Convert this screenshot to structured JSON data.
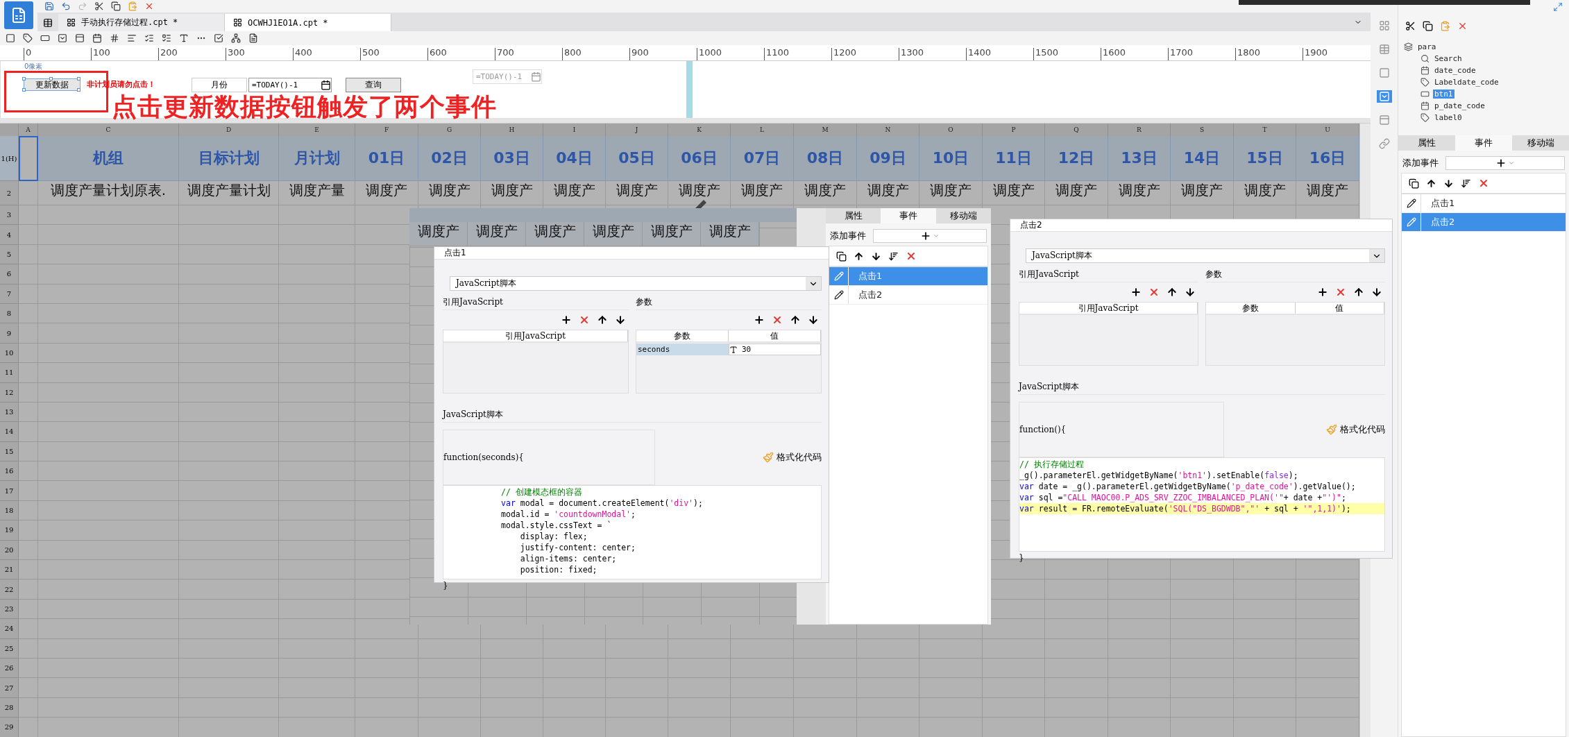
{
  "tabs": [
    {
      "label": "手动执行存储过程.cpt *",
      "selected": false
    },
    {
      "label": "OCWHJ1EO1A.cpt *",
      "selected": true
    }
  ],
  "ruler": {
    "ticks": [
      "0",
      "100",
      "200",
      "300",
      "400",
      "500",
      "600",
      "700",
      "800",
      "900",
      "1000",
      "1100",
      "1200",
      "1300",
      "1400",
      "1500",
      "1600",
      "1700",
      "1800",
      "1900"
    ]
  },
  "parameter_pane": {
    "size_hint": "0像素",
    "widgets": [
      {
        "kind": "button",
        "text": "更新数据",
        "selected": true
      },
      {
        "kind": "warning",
        "text": "非计划员请勿点击！"
      },
      {
        "kind": "label",
        "text": "月份"
      },
      {
        "kind": "date",
        "value": "=TODAY()-1"
      },
      {
        "kind": "button",
        "text": "查询",
        "selected": false
      },
      {
        "kind": "date_disabled",
        "value": "=TODAY()-1"
      }
    ]
  },
  "annotation": {
    "text": "点击更新数据按钮触发了两个事件"
  },
  "sheet": {
    "columns": [
      "A",
      "C",
      "D",
      "E",
      "F",
      "G",
      "H",
      "I",
      "J",
      "K",
      "L",
      "M",
      "N",
      "O",
      "P",
      "Q",
      "R",
      "S",
      "T",
      "U"
    ],
    "row_numbers": [
      "1(H)",
      "2",
      "3",
      "4",
      "5",
      "6",
      "7",
      "8",
      "9",
      "10",
      "11",
      "12",
      "13",
      "14",
      "15",
      "16",
      "17",
      "18",
      "19",
      "20",
      "21",
      "22",
      "23",
      "24",
      "25",
      "26",
      "27",
      "28",
      "29"
    ],
    "header_row": [
      "机组",
      "目标计划",
      "月计划",
      "01日",
      "02日",
      "03日",
      "04日",
      "05日",
      "06日",
      "07日",
      "08日",
      "09日",
      "10日",
      "11日",
      "12日",
      "13日",
      "14日",
      "15日",
      "16日"
    ],
    "second_row": [
      "调度产量计划原表.",
      "调度产量计划",
      "调度产量",
      "调度产",
      "调度产",
      "调度产",
      "调度产",
      "调度产",
      "调度产",
      "调度产",
      "调度产",
      "调度产",
      "调度产",
      "调度产",
      "调度产",
      "调度产",
      "调度产",
      "调度产",
      "调度产"
    ]
  },
  "widget_panel": {
    "tree": [
      {
        "label": "para",
        "selected": false,
        "children": [
          {
            "label": "Search",
            "selected": false
          },
          {
            "label": "date_code",
            "selected": false
          },
          {
            "label": "Labeldate_code",
            "selected": false
          },
          {
            "label": "btn1",
            "selected": true
          },
          {
            "label": "p_date_code",
            "selected": false
          },
          {
            "label": "label0",
            "selected": false
          }
        ]
      }
    ],
    "events": {
      "tabs": [
        {
          "label": "属性",
          "selected": false
        },
        {
          "label": "事件",
          "selected": true
        },
        {
          "label": "移动端",
          "selected": false
        }
      ],
      "add_label": "添加事件",
      "items": [
        {
          "label": "点击1",
          "selected": false
        },
        {
          "label": "点击2",
          "selected": true
        }
      ]
    }
  },
  "overlay_1": {
    "sheet_cells": [
      "调度产",
      "调度产",
      "调度产",
      "调度产",
      "调度产",
      "调度产"
    ],
    "dialog": {
      "title": "点击1",
      "script_type": "JavaScript脚本",
      "ref_label": "引用JavaScript",
      "ref_column": "引用JavaScript",
      "params_label": "参数",
      "params_columns": [
        "参数",
        "值"
      ],
      "params_rows": [
        {
          "name": "seconds",
          "value": "30"
        }
      ],
      "script_label": "JavaScript脚本",
      "function_header": "function(seconds){",
      "format_button": "格式化代码",
      "code": [
        {
          "kind": "block",
          "highlighted": false,
          "tokens": [
            {
              "kind": "comment",
              "text": "// 创建模态框的容器"
            }
          ]
        },
        {
          "kind": "block",
          "highlighted": false,
          "tokens": [
            {
              "kind": "keyword",
              "text": "var"
            },
            {
              "kind": "plain",
              "text": " modal = document.createElement("
            },
            {
              "kind": "string",
              "text": "'div'"
            },
            {
              "kind": "plain",
              "text": ");"
            }
          ]
        },
        {
          "kind": "block",
          "highlighted": false,
          "tokens": [
            {
              "kind": "plain",
              "text": "modal.id = "
            },
            {
              "kind": "string",
              "text": "'countdownModal'"
            },
            {
              "kind": "plain",
              "text": ";"
            }
          ]
        },
        {
          "kind": "block",
          "highlighted": false,
          "tokens": [
            {
              "kind": "plain",
              "text": "modal.style.cssText = `"
            }
          ]
        },
        {
          "kind": "inner",
          "highlighted": false,
          "tokens": [
            {
              "kind": "plain",
              "text": "display: flex;"
            }
          ]
        },
        {
          "kind": "inner",
          "highlighted": false,
          "tokens": [
            {
              "kind": "plain",
              "text": "justify-content: center;"
            }
          ]
        },
        {
          "kind": "inner",
          "highlighted": false,
          "tokens": [
            {
              "kind": "plain",
              "text": "align-items: center;"
            }
          ]
        },
        {
          "kind": "inner",
          "highlighted": false,
          "tokens": [
            {
              "kind": "plain",
              "text": "position: fixed;"
            }
          ]
        }
      ],
      "closing": "}"
    },
    "events": {
      "tabs": [
        {
          "label": "属性",
          "selected": false
        },
        {
          "label": "事件",
          "selected": true
        },
        {
          "label": "移动端",
          "selected": false
        }
      ],
      "add_label": "添加事件",
      "items": [
        {
          "label": "点击1",
          "selected": true
        },
        {
          "label": "点击2",
          "selected": false
        }
      ]
    }
  },
  "overlay_2": {
    "dialog": {
      "title": "点击2",
      "script_type": "JavaScript脚本",
      "ref_label": "引用JavaScript",
      "ref_column": "引用JavaScript",
      "params_label": "参数",
      "params_columns": [
        "参数",
        "值"
      ],
      "script_label": "JavaScript脚本",
      "function_header": "function(){",
      "format_button": "格式化代码",
      "code": [
        {
          "kind": "top",
          "highlighted": false,
          "tokens": [
            {
              "kind": "comment",
              "text": "// 执行存储过程"
            }
          ]
        },
        {
          "kind": "top",
          "highlighted": false,
          "tokens": [
            {
              "kind": "plain",
              "text": "_g().parameterEl.getWidgetByName("
            },
            {
              "kind": "string",
              "text": "'btn1'"
            },
            {
              "kind": "plain",
              "text": ").setEnable("
            },
            {
              "kind": "literal",
              "text": "false"
            },
            {
              "kind": "plain",
              "text": ");"
            }
          ]
        },
        {
          "kind": "top",
          "highlighted": false,
          "tokens": [
            {
              "kind": "keyword",
              "text": "var"
            },
            {
              "kind": "plain",
              "text": " date = _g().parameterEl.getWidgetByName("
            },
            {
              "kind": "string",
              "text": "'p_date_code'"
            },
            {
              "kind": "plain",
              "text": ").getValue();"
            }
          ]
        },
        {
          "kind": "top",
          "highlighted": false,
          "tokens": [
            {
              "kind": "keyword",
              "text": "var"
            },
            {
              "kind": "plain",
              "text": " sql ="
            },
            {
              "kind": "string",
              "text": "\"CALL MAOC00.P_ADS_SRV_ZZOC_IMBALANCED_PLAN('\""
            },
            {
              "kind": "plain",
              "text": "+ date +"
            },
            {
              "kind": "string",
              "text": "\"')\""
            },
            {
              "kind": "plain",
              "text": ";"
            }
          ]
        },
        {
          "kind": "top",
          "highlighted": true,
          "tokens": [
            {
              "kind": "keyword",
              "text": "var"
            },
            {
              "kind": "plain",
              "text": " result = FR.remoteEvaluate("
            },
            {
              "kind": "string",
              "text": "'SQL(\"DS_BGDWDB\",\"' "
            },
            {
              "kind": "plain",
              "text": "+ sql + "
            },
            {
              "kind": "string",
              "text": "'\",1,1)'"
            },
            {
              "kind": "plain",
              "text": ");"
            }
          ]
        }
      ],
      "closing": "}"
    }
  }
}
